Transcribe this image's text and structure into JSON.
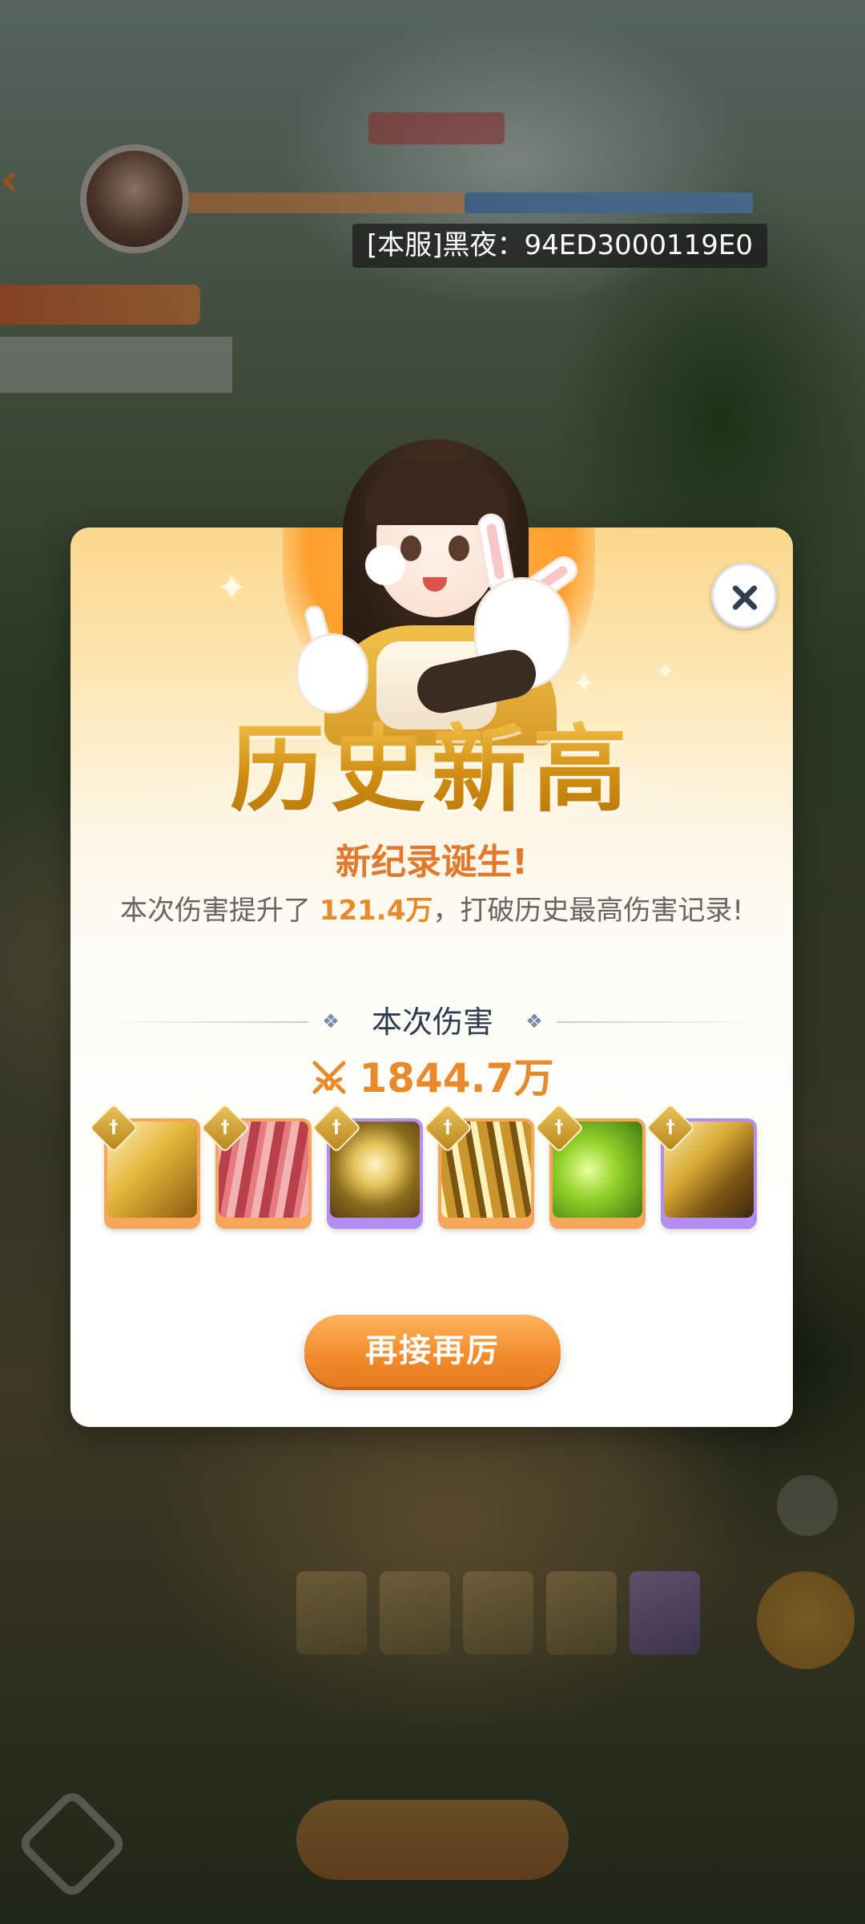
{
  "server_tag": "[本服]黑夜：94ED3000119E0",
  "modal": {
    "headline": "历史新高",
    "sub_title": "新纪录诞生!",
    "desc_prefix": "本次伤害提升了 ",
    "desc_value": "121.4万",
    "desc_suffix": "，打破历史最高伤害记录!",
    "section_title": "本次伤害",
    "damage_value": "1844.7万",
    "retry_label": "再接再厉",
    "skills": [
      {
        "name": "golden-sword-slash",
        "frame": "orange"
      },
      {
        "name": "crimson-blades",
        "frame": "orange"
      },
      {
        "name": "golden-ring-strike",
        "frame": "purple"
      },
      {
        "name": "golden-sword-rain",
        "frame": "orange"
      },
      {
        "name": "green-wind-slash",
        "frame": "orange"
      },
      {
        "name": "golden-whirl",
        "frame": "purple"
      }
    ]
  },
  "colors": {
    "accent_orange": "#e88a2c",
    "frame_orange": "#f5a65a",
    "frame_purple": "#b48df0",
    "headline_gold": "#d6981f"
  }
}
